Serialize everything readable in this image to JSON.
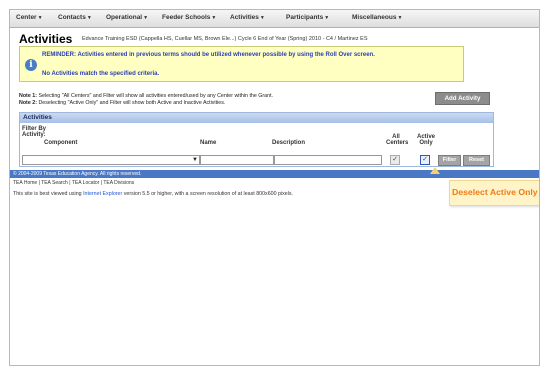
{
  "menu": [
    {
      "label": "Center"
    },
    {
      "label": "Contacts"
    },
    {
      "label": "Operational"
    },
    {
      "label": "Feeder Schools"
    },
    {
      "label": "Activities"
    },
    {
      "label": "Participants"
    },
    {
      "label": "Miscellaneous"
    }
  ],
  "page": {
    "title": "Activities",
    "context": "Edvance Training ESD (Cappella HS, Cuellar MS, Brown Ele...)  Cycle 6  End of Year (Spring)  2010 - C4 / Martinez ES"
  },
  "reminder": {
    "text": "REMINDER: Activities entered in previous terms should be utilized whenever possible by using the Roll Over screen.",
    "no_match": "No Activities match the specified criteria."
  },
  "notes": {
    "note1_label": "Note 1:",
    "note1_text": "Selecting \"All Centers\" and Filter will show all activities entered/used by any Center within the Grant.",
    "note2_label": "Note 2:",
    "note2_text": "Deselecting \"Active Only\" and Filter will show both Active and Inactive Activities."
  },
  "toolbar": {
    "add_activity": "Add Activity"
  },
  "activities_panel": {
    "header": "Activities",
    "filter_by": "Filter By",
    "filter_by_2": "Activity:",
    "col_component": "Component",
    "col_name": "Name",
    "col_description": "Description",
    "col_all": "All",
    "col_centers": "Centers",
    "col_active": "Active",
    "col_only": "Only",
    "filter_button": "Filter",
    "reset_button": "Reset",
    "all_centers_checked": true,
    "active_only_checked": true
  },
  "footer": {
    "copyright": "© 2004-2009 Texas Education Agency. All rights reserved.",
    "links": "TEA Home | TEA Search | TEA Locator | TEA Divisions",
    "browser_note_pre": "This site is best viewed using ",
    "browser_link": "Internet Explorer",
    "browser_note_post": " version 5.5 or higher, with a screen resolution of at least 800x600 pixels."
  },
  "callout": {
    "text": "Deselect Active Only"
  },
  "colors": {
    "accent_blue": "#4a78c4",
    "callout_orange": "#f07a18",
    "reminder_bg": "#ffffc2"
  }
}
